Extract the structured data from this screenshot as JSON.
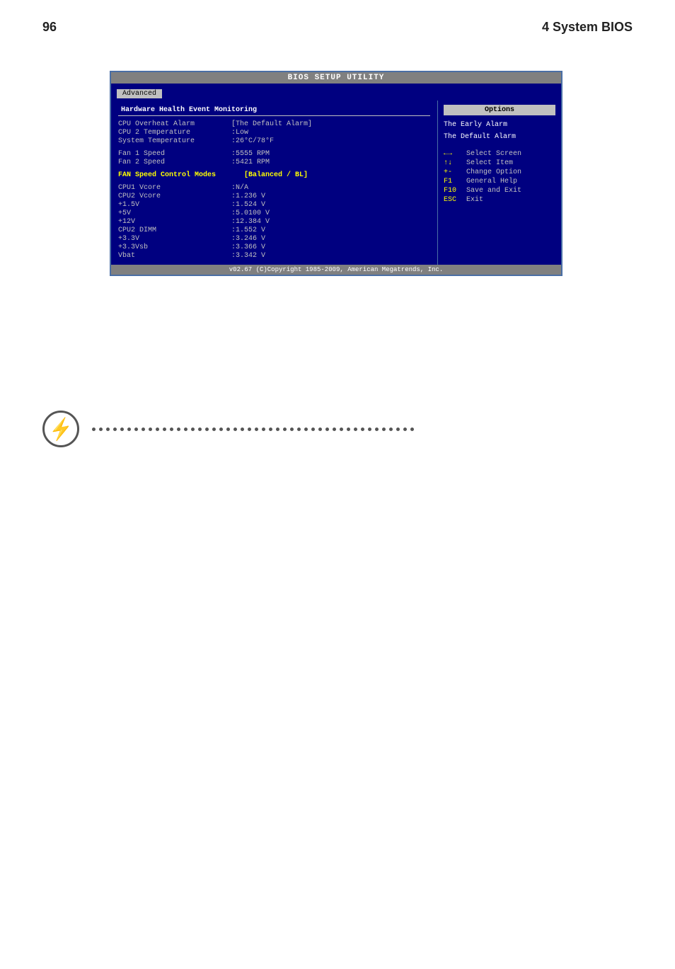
{
  "page": {
    "number": "96",
    "chapter": "4 System BIOS"
  },
  "bios": {
    "title": "BIOS SETUP UTILITY",
    "tab": "Advanced",
    "section_left": "Hardware Health Event Monitoring",
    "section_right_options": "Options",
    "rows": [
      {
        "label": "CPU Overheat Alarm",
        "value": "[The Default Alarm]",
        "highlight": false
      },
      {
        "label": "CPU 2 Temperature",
        "value": ":Low",
        "highlight": false
      },
      {
        "label": "System Temperature",
        "value": ":26°C/78°F",
        "highlight": false
      },
      {
        "label": "",
        "value": "",
        "highlight": false
      },
      {
        "label": "Fan 1 Speed",
        "value": ":5555 RPM",
        "highlight": false
      },
      {
        "label": "Fan 2 Speed",
        "value": ":5421 RPM",
        "highlight": false
      },
      {
        "label": "",
        "value": "",
        "highlight": false
      },
      {
        "label": "FAN Speed Control Modes",
        "value": "[Balanced / BL]",
        "highlight": true
      },
      {
        "label": "",
        "value": "",
        "highlight": false
      },
      {
        "label": "CPU1 Vcore",
        "value": ":N/A",
        "highlight": false
      },
      {
        "label": "CPU2 Vcore",
        "value": ":1.236 V",
        "highlight": false
      },
      {
        "label": "+1.5V",
        "value": ":1.524 V",
        "highlight": false
      },
      {
        "label": "+5V",
        "value": ":5.0100 V",
        "highlight": false
      },
      {
        "label": "+12V",
        "value": ":12.384 V",
        "highlight": false
      },
      {
        "label": "CPU2 DIMM",
        "value": ":1.552 V",
        "highlight": false
      },
      {
        "label": "+3.3V",
        "value": ":3.246 V",
        "highlight": false
      },
      {
        "label": "+3.3Vsb",
        "value": ":3.366 V",
        "highlight": false
      },
      {
        "label": "Vbat",
        "value": ":3.342 V",
        "highlight": false
      }
    ],
    "options_text": [
      "The Early Alarm",
      "The Default Alarm"
    ],
    "keybinds": [
      {
        "key": "←→",
        "desc": "Select Screen"
      },
      {
        "key": "↑↓",
        "desc": "Select Item"
      },
      {
        "key": "+-",
        "desc": "Change Option"
      },
      {
        "key": "F1",
        "desc": "General Help"
      },
      {
        "key": "F10",
        "desc": "Save and Exit"
      },
      {
        "key": "ESC",
        "desc": "Exit"
      }
    ],
    "footer": "v02.67 (C)Copyright 1985-2009, American Megatrends, Inc."
  },
  "dots": {
    "count": 46
  }
}
